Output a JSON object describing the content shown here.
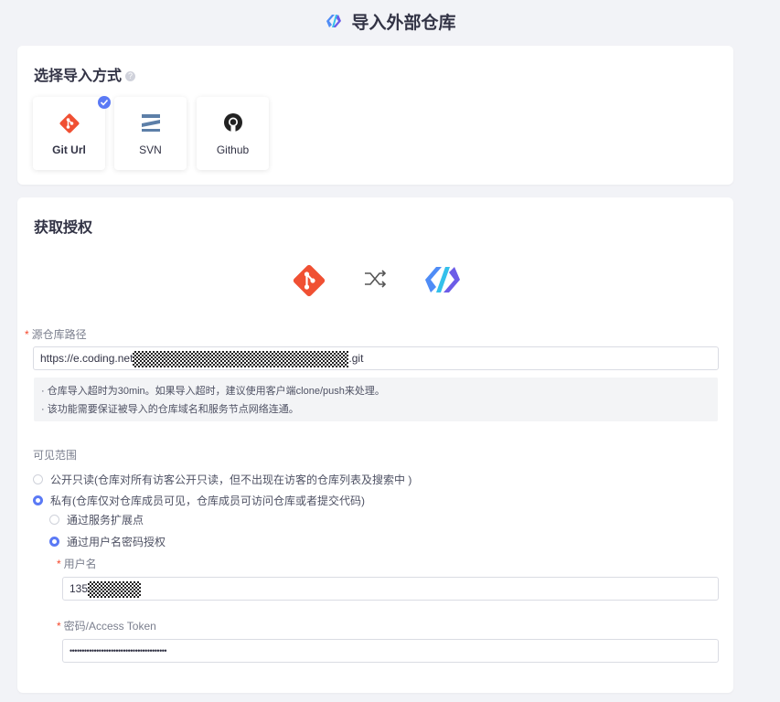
{
  "header": {
    "title": "导入外部仓库"
  },
  "method_section": {
    "title": "选择导入方式",
    "help": "?",
    "options": [
      {
        "label": "Git Url",
        "selected": true
      },
      {
        "label": "SVN",
        "selected": false
      },
      {
        "label": "Github",
        "selected": false
      }
    ]
  },
  "auth_section": {
    "title": "获取授权",
    "repo_path": {
      "required_mark": "*",
      "label": "源仓库路径",
      "value_prefix": "https://e.coding.net",
      "value_suffix": ".git"
    },
    "tips": [
      "· 仓库导入超时为30min。如果导入超时，建议使用客户端clone/push来处理。",
      "· 该功能需要保证被导入的仓库域名和服务节点网络连通。"
    ],
    "visibility": {
      "label": "可见范围",
      "public_label": "公开只读(仓库对所有访客公开只读，但不出现在访客的仓库列表及搜索中 )",
      "private_label": "私有(仓库仅对仓库成员可见，仓库成员可访问仓库或者提交代码)",
      "selected": "private"
    },
    "auth_method": {
      "service_label": "通过服务扩展点",
      "password_label": "通过用户名密码授权",
      "selected": "password"
    },
    "username": {
      "required_mark": "*",
      "label": "用户名",
      "value_prefix": "135"
    },
    "password": {
      "required_mark": "*",
      "label": "密码/Access Token",
      "value": "••••••••••••••••••••••••••••••••••••••••"
    }
  },
  "colors": {
    "accent": "#5b7af5",
    "git": "#f05033",
    "required": "#f5462a",
    "background": "#f2f3f7"
  }
}
